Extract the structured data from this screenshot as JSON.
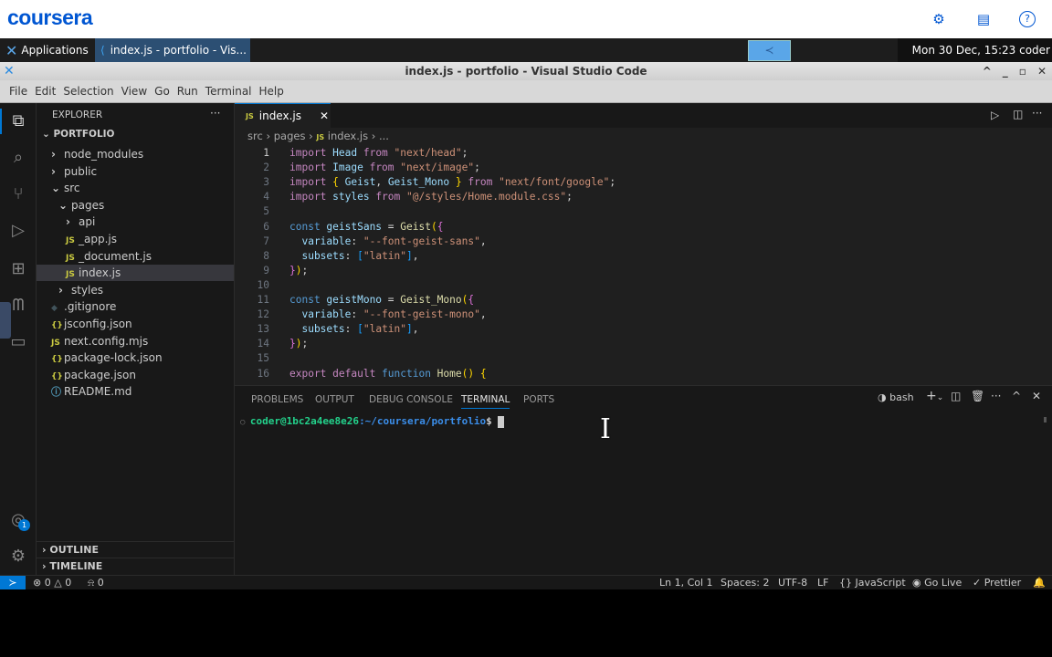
{
  "coursera": {
    "logo": "coursera",
    "icons": [
      "translate-icon",
      "notes-icon",
      "help-icon"
    ]
  },
  "taskbar": {
    "applications": "Applications",
    "window_title": "index.js - portfolio - Vis...",
    "clock": "Mon 30 Dec, 15:23 coder"
  },
  "window": {
    "title": "index.js - portfolio - Visual Studio Code"
  },
  "menu": [
    "File",
    "Edit",
    "Selection",
    "View",
    "Go",
    "Run",
    "Terminal",
    "Help"
  ],
  "explorer": {
    "title": "EXPLORER",
    "root": "PORTFOLIO",
    "items": [
      {
        "label": "node_modules",
        "type": "folder",
        "depth": 1,
        "open": false
      },
      {
        "label": "public",
        "type": "folder",
        "depth": 1,
        "open": false
      },
      {
        "label": "src",
        "type": "folder",
        "depth": 1,
        "open": true
      },
      {
        "label": "pages",
        "type": "folder",
        "depth": 2,
        "open": true
      },
      {
        "label": "api",
        "type": "folder",
        "depth": 3,
        "open": false
      },
      {
        "label": "_app.js",
        "type": "js",
        "depth": 3
      },
      {
        "label": "_document.js",
        "type": "js",
        "depth": 3
      },
      {
        "label": "index.js",
        "type": "js",
        "depth": 3,
        "selected": true
      },
      {
        "label": "styles",
        "type": "folder",
        "depth": 2,
        "open": false
      },
      {
        "label": ".gitignore",
        "type": "git",
        "depth": 1
      },
      {
        "label": "jsconfig.json",
        "type": "json",
        "depth": 1
      },
      {
        "label": "next.config.mjs",
        "type": "js",
        "depth": 1
      },
      {
        "label": "package-lock.json",
        "type": "json",
        "depth": 1
      },
      {
        "label": "package.json",
        "type": "json",
        "depth": 1
      },
      {
        "label": "README.md",
        "type": "info",
        "depth": 1
      }
    ],
    "outline": "OUTLINE",
    "timeline": "TIMELINE"
  },
  "accounts_badge": "1",
  "editor": {
    "tab": "index.js",
    "breadcrumb": [
      "src",
      "pages",
      "index.js",
      "..."
    ],
    "lines": [
      [
        [
          "import ",
          "kw"
        ],
        [
          "Head ",
          "vr"
        ],
        [
          "from ",
          "kw"
        ],
        [
          "\"next/head\"",
          "st"
        ],
        [
          ";",
          "pl"
        ]
      ],
      [
        [
          "import ",
          "kw"
        ],
        [
          "Image ",
          "vr"
        ],
        [
          "from ",
          "kw"
        ],
        [
          "\"next/image\"",
          "st"
        ],
        [
          ";",
          "pl"
        ]
      ],
      [
        [
          "import ",
          "kw"
        ],
        [
          "{ ",
          "b1"
        ],
        [
          "Geist",
          "vr"
        ],
        [
          ", ",
          "pl"
        ],
        [
          "Geist_Mono ",
          "vr"
        ],
        [
          "} ",
          "b1"
        ],
        [
          "from ",
          "kw"
        ],
        [
          "\"next/font/google\"",
          "st"
        ],
        [
          ";",
          "pl"
        ]
      ],
      [
        [
          "import ",
          "kw"
        ],
        [
          "styles ",
          "vr"
        ],
        [
          "from ",
          "kw"
        ],
        [
          "\"@/styles/Home.module.css\"",
          "st"
        ],
        [
          ";",
          "pl"
        ]
      ],
      [],
      [
        [
          "const ",
          "ct"
        ],
        [
          "geistSans ",
          "vr"
        ],
        [
          "= ",
          "pl"
        ],
        [
          "Geist",
          "fn"
        ],
        [
          "(",
          "b1"
        ],
        [
          "{",
          "b2"
        ]
      ],
      [
        [
          "  variable",
          "vr"
        ],
        [
          ": ",
          "pl"
        ],
        [
          "\"--font-geist-sans\"",
          "st"
        ],
        [
          ",",
          "pl"
        ]
      ],
      [
        [
          "  subsets",
          "vr"
        ],
        [
          ": ",
          "pl"
        ],
        [
          "[",
          "b3"
        ],
        [
          "\"latin\"",
          "st"
        ],
        [
          "]",
          "b3"
        ],
        [
          ",",
          "pl"
        ]
      ],
      [
        [
          "}",
          "b2"
        ],
        [
          ")",
          "b1"
        ],
        [
          ";",
          "pl"
        ]
      ],
      [],
      [
        [
          "const ",
          "ct"
        ],
        [
          "geistMono ",
          "vr"
        ],
        [
          "= ",
          "pl"
        ],
        [
          "Geist_Mono",
          "fn"
        ],
        [
          "(",
          "b1"
        ],
        [
          "{",
          "b2"
        ]
      ],
      [
        [
          "  variable",
          "vr"
        ],
        [
          ": ",
          "pl"
        ],
        [
          "\"--font-geist-mono\"",
          "st"
        ],
        [
          ",",
          "pl"
        ]
      ],
      [
        [
          "  subsets",
          "vr"
        ],
        [
          ": ",
          "pl"
        ],
        [
          "[",
          "b3"
        ],
        [
          "\"latin\"",
          "st"
        ],
        [
          "]",
          "b3"
        ],
        [
          ",",
          "pl"
        ]
      ],
      [
        [
          "}",
          "b2"
        ],
        [
          ")",
          "b1"
        ],
        [
          ";",
          "pl"
        ]
      ],
      [],
      [
        [
          "export ",
          "kw"
        ],
        [
          "default ",
          "kw"
        ],
        [
          "function ",
          "ct"
        ],
        [
          "Home",
          "fn"
        ],
        [
          "() ",
          "b1"
        ],
        [
          "{",
          "b1"
        ]
      ]
    ]
  },
  "panel": {
    "tabs": [
      "PROBLEMS",
      "OUTPUT",
      "DEBUG CONSOLE",
      "TERMINAL",
      "PORTS"
    ],
    "active": "TERMINAL",
    "shell": "bash",
    "prompt_user": "coder@1bc2a4ee8e26",
    "prompt_path": ":~/coursera/portfolio",
    "prompt_end": "$ "
  },
  "status": {
    "errors": "0",
    "warnings": "0",
    "ports": "0",
    "position": "Ln 1, Col 1",
    "spaces": "Spaces: 2",
    "encoding": "UTF-8",
    "eol": "LF",
    "language": "JavaScript",
    "golive": "Go Live",
    "prettier": "Prettier"
  }
}
